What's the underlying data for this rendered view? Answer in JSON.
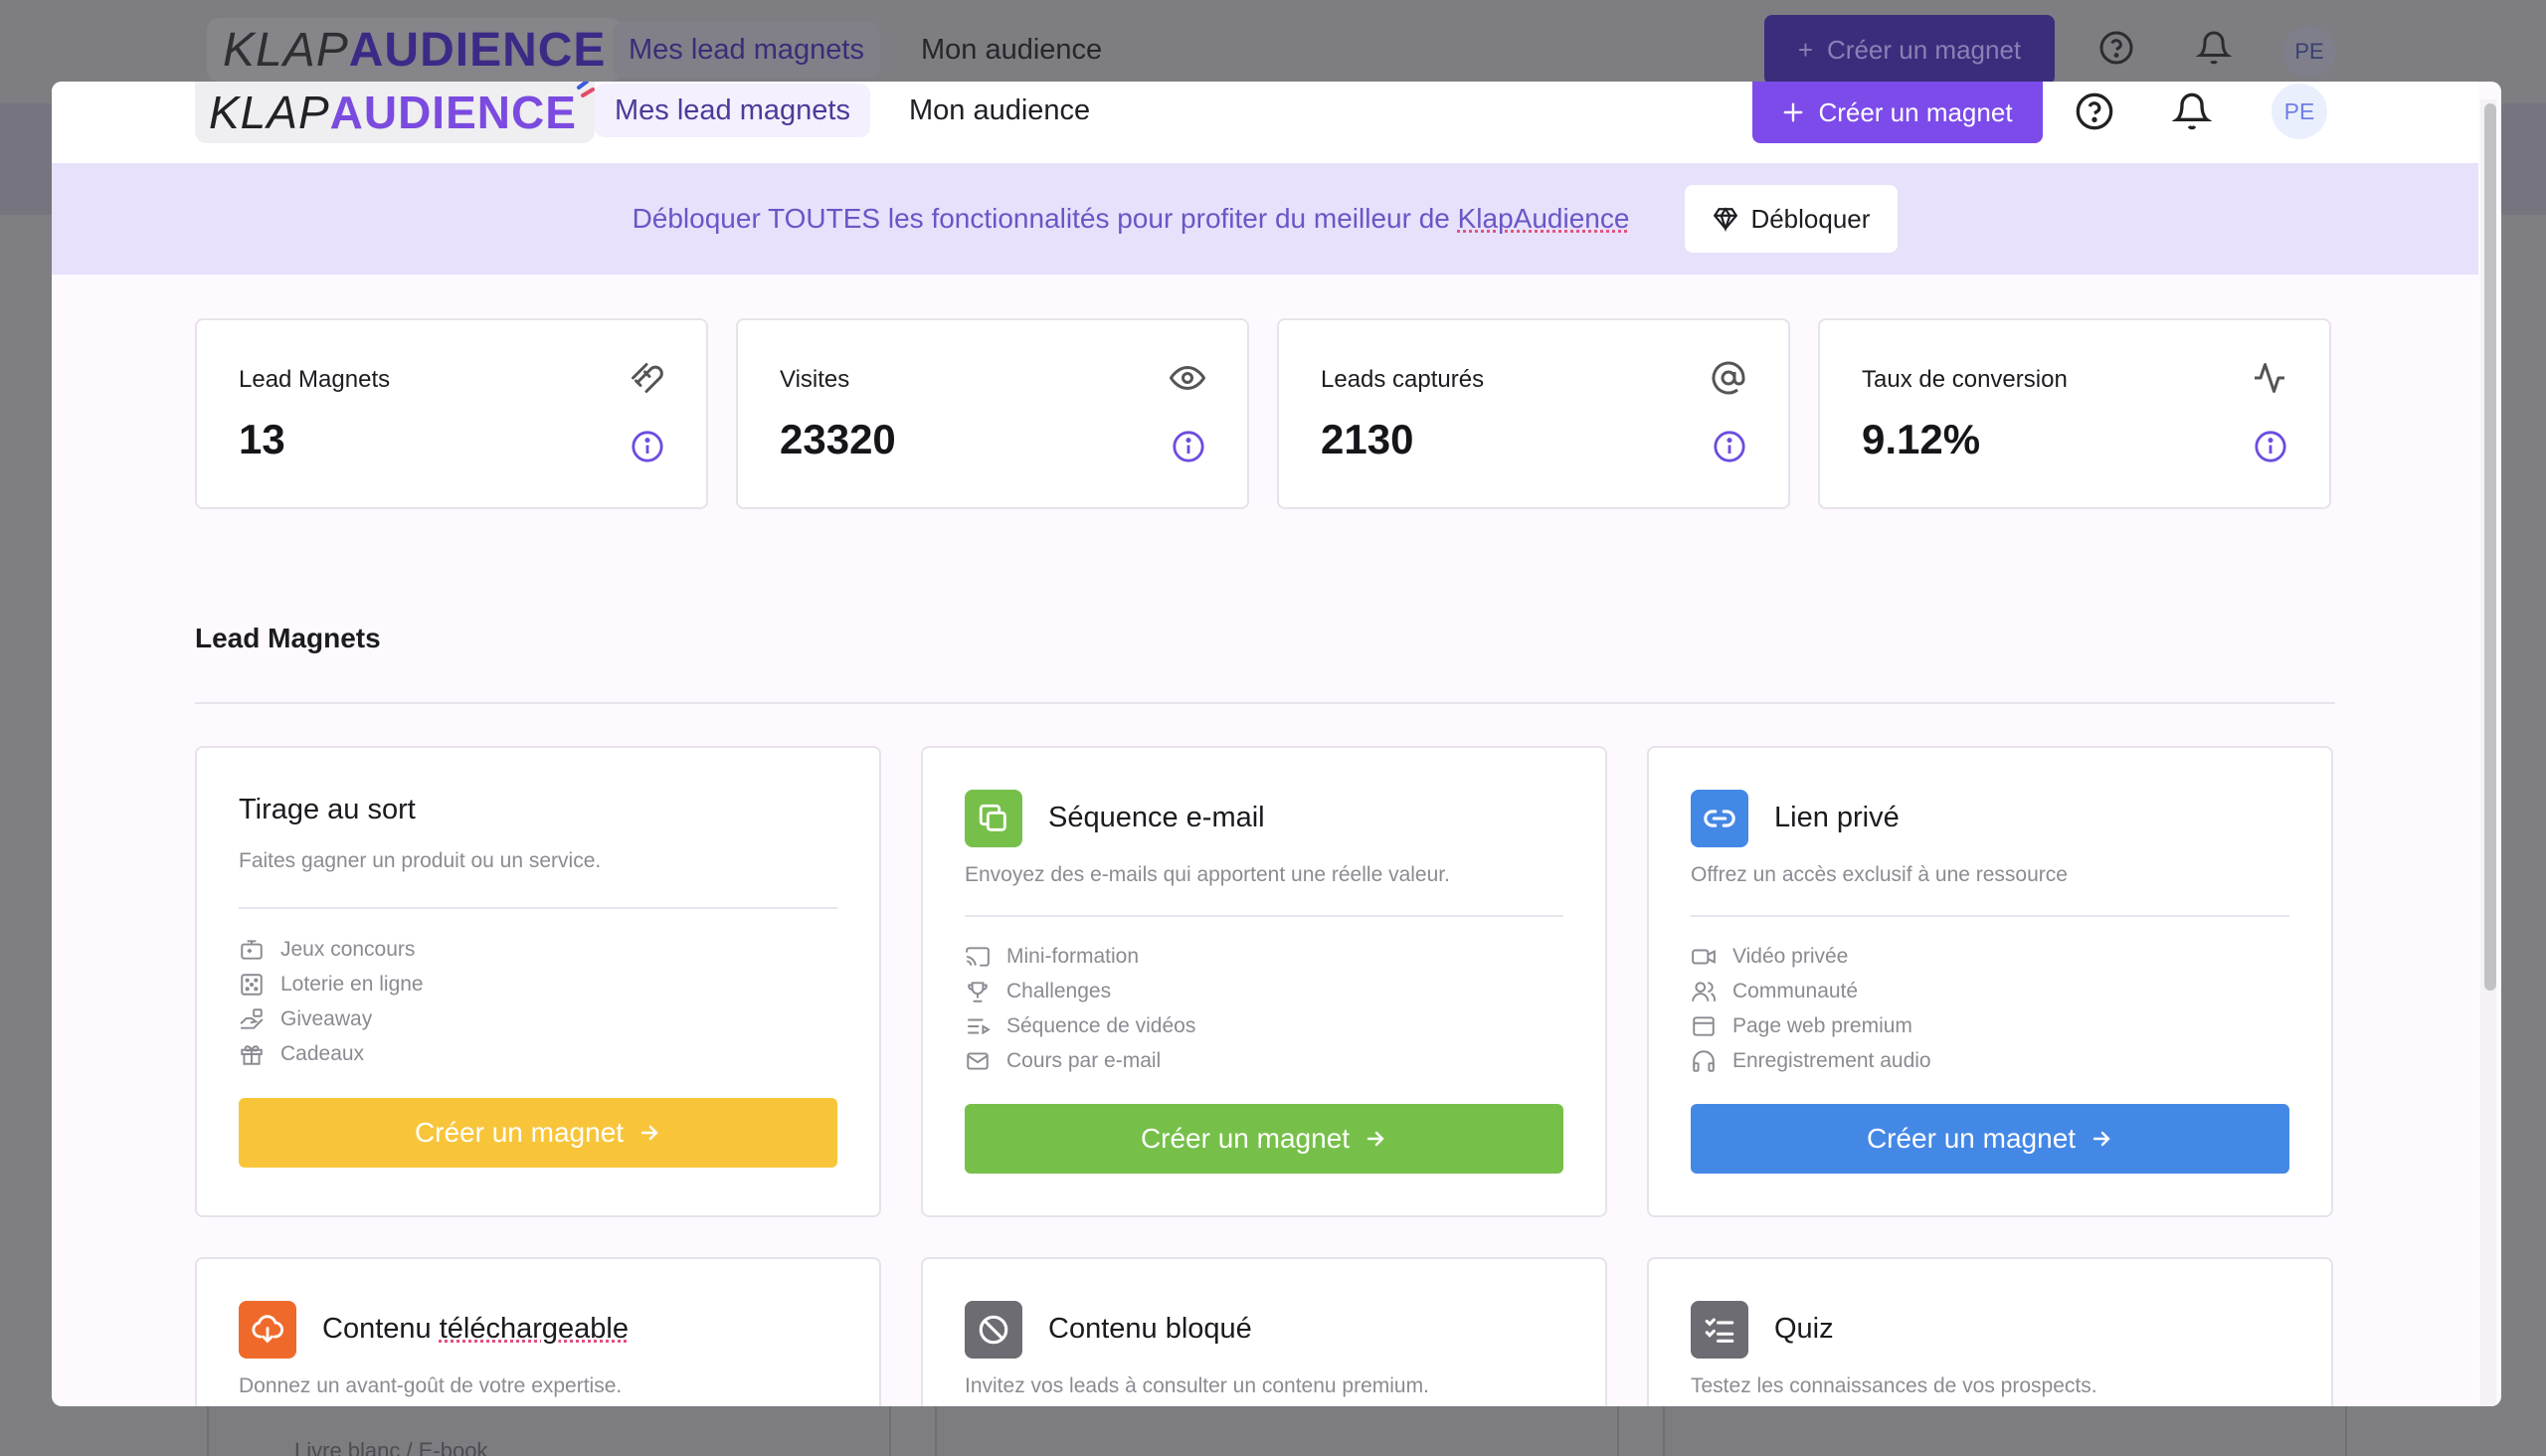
{
  "background": {
    "logo": {
      "part1": "KLAP",
      "part2": "AUDIENCE"
    },
    "nav": [
      "Mes lead magnets",
      "Mon audience"
    ],
    "cta": "Créer un magnet",
    "avatar": "PE",
    "card_feature": "Livre blanc / E-book"
  },
  "header": {
    "logo": {
      "part1": "KLAP",
      "part2": "AUDIENCE"
    },
    "nav": [
      {
        "label": "Mes lead magnets",
        "active": true
      },
      {
        "label": "Mon audience",
        "active": false
      }
    ],
    "cta": "Créer un magnet",
    "icons": [
      "help-icon",
      "bell-icon"
    ],
    "avatar": "PE"
  },
  "promo": {
    "text": "Débloquer TOUTES les fonctionnalités pour profiter du meilleur de ",
    "brand": "KlapAudience",
    "button": "Débloquer",
    "button_icon": "diamond-icon"
  },
  "stats": [
    {
      "label": "Lead Magnets",
      "value": "13",
      "icon": "magnet-icon"
    },
    {
      "label": "Visites",
      "value": "23320",
      "icon": "eye-icon"
    },
    {
      "label": "Leads capturés",
      "value": "2130",
      "icon": "at-icon"
    },
    {
      "label": "Taux de conversion",
      "value": "9.12%",
      "icon": "pulse-icon"
    }
  ],
  "section": {
    "title": "Lead Magnets"
  },
  "cards": [
    {
      "title": "Tirage au sort",
      "description": "Faites gagner un produit ou un service.",
      "features": [
        "Jeux concours",
        "Loterie en ligne",
        "Giveaway",
        "Cadeaux"
      ],
      "button": "Créer un magnet",
      "color": "#f8c53a"
    },
    {
      "title": "Séquence e-mail",
      "description": "Envoyez des e-mails qui apportent une réelle valeur.",
      "features": [
        "Mini-formation",
        "Challenges",
        "Séquence de vidéos",
        "Cours par e-mail"
      ],
      "button": "Créer un magnet",
      "color": "#76c04a"
    },
    {
      "title": "Lien privé",
      "description": "Offrez un accès exclusif à une ressource",
      "features": [
        "Vidéo privée",
        "Communauté",
        "Page web premium",
        "Enregistrement audio"
      ],
      "button": "Créer un magnet",
      "color": "#4488e6"
    },
    {
      "title_prefix": "Contenu ",
      "title_underlined": "téléchargeable",
      "description": "Donnez un avant-goût de votre expertise.",
      "color": "#ef6a2a"
    },
    {
      "title": "Contenu bloqué",
      "description": "Invitez vos leads à consulter un contenu premium.",
      "color": "#6c6c72"
    },
    {
      "title": "Quiz",
      "description": "Testez les connaissances de vos prospects.",
      "color": "#6c6c72"
    }
  ]
}
